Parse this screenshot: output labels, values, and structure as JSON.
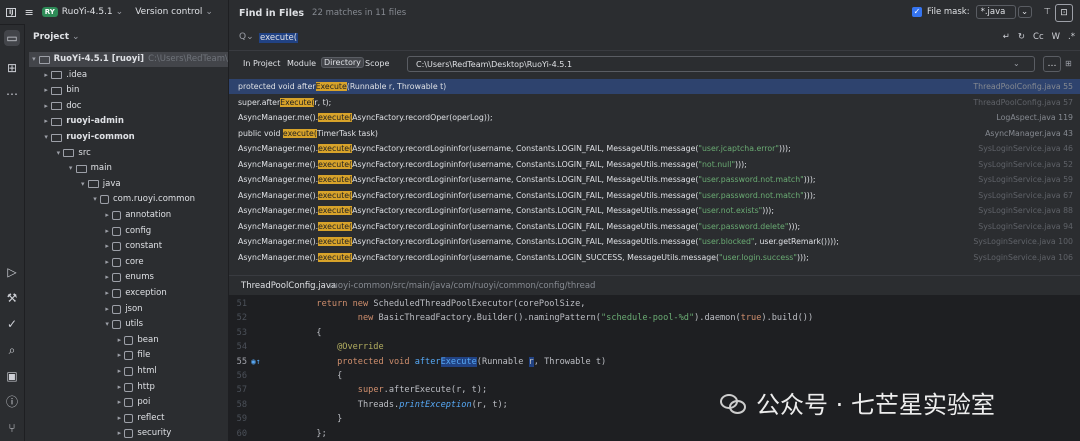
{
  "titlebar": {
    "menu_icon": "hamburger-icon",
    "project_badge": "RY",
    "project_name": "RuoYi-4.5.1",
    "vcs_label": "Version control"
  },
  "project_panel": {
    "title": "Project",
    "tree": [
      {
        "label": "RuoYi-4.5.1 [ruoyi]",
        "suffix": "C:\\Users\\RedTeam\\Desk",
        "level": 0,
        "expanded": true,
        "bold": true,
        "kind": "module"
      },
      {
        "label": ".idea",
        "level": 1,
        "expanded": false,
        "kind": "folder"
      },
      {
        "label": "bin",
        "level": 1,
        "expanded": false,
        "kind": "folder"
      },
      {
        "label": "doc",
        "level": 1,
        "expanded": false,
        "kind": "folder"
      },
      {
        "label": "ruoyi-admin",
        "level": 1,
        "expanded": false,
        "bold": true,
        "kind": "module"
      },
      {
        "label": "ruoyi-common",
        "level": 1,
        "expanded": true,
        "bold": true,
        "kind": "module"
      },
      {
        "label": "src",
        "level": 2,
        "expanded": true,
        "kind": "folder"
      },
      {
        "label": "main",
        "level": 3,
        "expanded": true,
        "kind": "folder"
      },
      {
        "label": "java",
        "level": 4,
        "expanded": true,
        "kind": "folder"
      },
      {
        "label": "com.ruoyi.common",
        "level": 5,
        "expanded": true,
        "kind": "package"
      },
      {
        "label": "annotation",
        "level": 6,
        "expanded": false,
        "kind": "package"
      },
      {
        "label": "config",
        "level": 6,
        "expanded": false,
        "kind": "package"
      },
      {
        "label": "constant",
        "level": 6,
        "expanded": false,
        "kind": "package"
      },
      {
        "label": "core",
        "level": 6,
        "expanded": false,
        "kind": "package"
      },
      {
        "label": "enums",
        "level": 6,
        "expanded": false,
        "kind": "package"
      },
      {
        "label": "exception",
        "level": 6,
        "expanded": false,
        "kind": "package"
      },
      {
        "label": "json",
        "level": 6,
        "expanded": false,
        "kind": "package"
      },
      {
        "label": "utils",
        "level": 6,
        "expanded": true,
        "kind": "package"
      },
      {
        "label": "bean",
        "level": 7,
        "expanded": false,
        "kind": "package"
      },
      {
        "label": "file",
        "level": 7,
        "expanded": false,
        "kind": "package"
      },
      {
        "label": "html",
        "level": 7,
        "expanded": false,
        "kind": "package"
      },
      {
        "label": "http",
        "level": 7,
        "expanded": false,
        "kind": "package"
      },
      {
        "label": "poi",
        "level": 7,
        "expanded": false,
        "kind": "package"
      },
      {
        "label": "reflect",
        "level": 7,
        "expanded": false,
        "kind": "package"
      },
      {
        "label": "security",
        "level": 7,
        "expanded": false,
        "kind": "package"
      }
    ]
  },
  "find": {
    "title": "Find in Files",
    "count": "22 matches in 11 files",
    "file_mask_label": "File mask:",
    "file_mask_value": "*.java",
    "query": "execute(",
    "search_icon": "search-icon",
    "option_labels": {
      "cc": "Cc",
      "w": "W",
      "regex": ".*"
    },
    "scopes": [
      "In Project",
      "Module",
      "Directory",
      "Scope"
    ],
    "active_scope": "Directory",
    "directory": "C:\\Users\\RedTeam\\Desktop\\RuoYi-4.5.1",
    "results": [
      {
        "pre": "protected void after",
        "match": "Execute",
        "post": "(Runnable r, Throwable t)",
        "loc": "ThreadPoolConfig.java 55",
        "selected": true,
        "dim": false
      },
      {
        "pre": "super.after",
        "match": "Execute(",
        "post": "r, t);",
        "loc": "ThreadPoolConfig.java 57",
        "selected": false,
        "dim": true
      },
      {
        "pre": "AsyncManager.me().",
        "match": "execute(",
        "post": "AsyncFactory.recordOper(operLog));",
        "loc": "LogAspect.java 119",
        "selected": false,
        "dim": false
      },
      {
        "pre": "public void ",
        "match": "execute(",
        "post": "TimerTask task)",
        "loc": "AsyncManager.java 43",
        "selected": false,
        "dim": false
      },
      {
        "pre": "AsyncManager.me().",
        "match": "execute(",
        "post": "AsyncFactory.recordLogininfor(username, Constants.LOGIN_FAIL, MessageUtils.message(",
        "str": "\"user.jcaptcha.error\"",
        "tail": ")));",
        "loc": "SysLoginService.java 46",
        "selected": false,
        "dim": true
      },
      {
        "pre": "AsyncManager.me().",
        "match": "execute(",
        "post": "AsyncFactory.recordLogininfor(username, Constants.LOGIN_FAIL, MessageUtils.message(",
        "str": "\"not.null\"",
        "tail": ")));",
        "loc": "SysLoginService.java 52",
        "selected": false,
        "dim": true
      },
      {
        "pre": "AsyncManager.me().",
        "match": "execute(",
        "post": "AsyncFactory.recordLogininfor(username, Constants.LOGIN_FAIL, MessageUtils.message(",
        "str": "\"user.password.not.match\"",
        "tail": ")));",
        "loc": "SysLoginService.java 59",
        "selected": false,
        "dim": true
      },
      {
        "pre": "AsyncManager.me().",
        "match": "execute(",
        "post": "AsyncFactory.recordLogininfor(username, Constants.LOGIN_FAIL, MessageUtils.message(",
        "str": "\"user.password.not.match\"",
        "tail": ")));",
        "loc": "SysLoginService.java 67",
        "selected": false,
        "dim": true
      },
      {
        "pre": "AsyncManager.me().",
        "match": "execute(",
        "post": "AsyncFactory.recordLogininfor(username, Constants.LOGIN_FAIL, MessageUtils.message(",
        "str": "\"user.not.exists\"",
        "tail": ")));",
        "loc": "SysLoginService.java 88",
        "selected": false,
        "dim": true
      },
      {
        "pre": "AsyncManager.me().",
        "match": "execute(",
        "post": "AsyncFactory.recordLogininfor(username, Constants.LOGIN_FAIL, MessageUtils.message(",
        "str": "\"user.password.delete\"",
        "tail": ")));",
        "loc": "SysLoginService.java 94",
        "selected": false,
        "dim": true
      },
      {
        "pre": "AsyncManager.me().",
        "match": "execute(",
        "post": "AsyncFactory.recordLogininfor(username, Constants.LOGIN_FAIL, MessageUtils.message(",
        "str": "\"user.blocked\"",
        "tail": ", user.getRemark())));",
        "loc": "SysLoginService.java 100",
        "selected": false,
        "dim": true
      },
      {
        "pre": "AsyncManager.me().",
        "match": "execute(",
        "post": "AsyncFactory.recordLogininfor(username, Constants.LOGIN_SUCCESS, MessageUtils.message(",
        "str": "\"user.login.success\"",
        "tail": ")));",
        "loc": "SysLoginService.java 106",
        "selected": false,
        "dim": true
      }
    ],
    "preview_file": "ThreadPoolConfig.java",
    "preview_path": "ruoyi-common/src/main/java/com/ruoyi/common/config/thread"
  },
  "code_lines": [
    {
      "n": "51",
      "segs": [
        [
          "        ",
          ""
        ],
        [
          "return new ",
          "kw"
        ],
        [
          "ScheduledThreadPoolExecutor(corePoolSize,",
          ""
        ]
      ]
    },
    {
      "n": "52",
      "segs": [
        [
          "                ",
          ""
        ],
        [
          "new ",
          "kw"
        ],
        [
          "BasicThreadFactory.Builder().namingPattern(",
          ""
        ],
        [
          "\"schedule-pool-%d\"",
          "str"
        ],
        [
          ").daemon(",
          ""
        ],
        [
          "true",
          "kw"
        ],
        [
          ").build())",
          ""
        ]
      ]
    },
    {
      "n": "53",
      "segs": [
        [
          "        {",
          ""
        ]
      ]
    },
    {
      "n": "54",
      "segs": [
        [
          "            ",
          ""
        ],
        [
          "@Override",
          "ann"
        ]
      ]
    },
    {
      "n": "55",
      "segs": [
        [
          "            ",
          ""
        ],
        [
          "protected void ",
          "kw"
        ],
        [
          "after",
          "fn"
        ],
        [
          "Execute",
          "fnhl"
        ],
        [
          "(Runnable ",
          ""
        ],
        [
          "r",
          "hl"
        ],
        [
          ", Throwable t)",
          ""
        ]
      ],
      "current": true,
      "marker": "override-marker-icon"
    },
    {
      "n": "56",
      "segs": [
        [
          "            {",
          ""
        ]
      ]
    },
    {
      "n": "57",
      "segs": [
        [
          "                ",
          ""
        ],
        [
          "super",
          "kw"
        ],
        [
          ".afterExecute(r, t);",
          ""
        ]
      ]
    },
    {
      "n": "58",
      "segs": [
        [
          "                Threads.",
          ""
        ],
        [
          "printException",
          "it"
        ],
        [
          "(r, t);",
          ""
        ]
      ]
    },
    {
      "n": "59",
      "segs": [
        [
          "            }",
          ""
        ]
      ]
    },
    {
      "n": "60",
      "segs": [
        [
          "        };",
          ""
        ]
      ]
    }
  ],
  "watermark": {
    "text": "公众号 · 七芒星实验室"
  },
  "colors": {
    "accent": "#3574f0",
    "match": "#d8a32a",
    "selected_row": "#2e436e",
    "string": "#6aab73",
    "keyword": "#cf8e6d"
  }
}
